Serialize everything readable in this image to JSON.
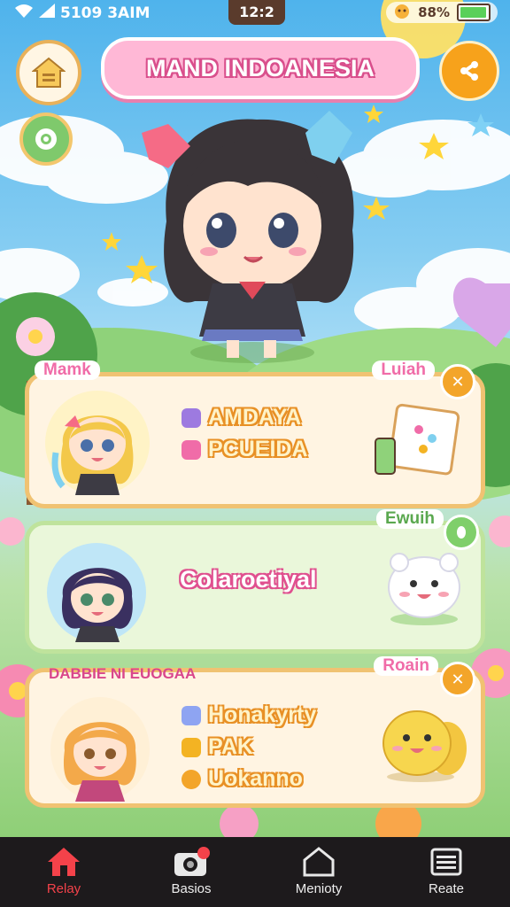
{
  "status_bar": {
    "left_text": "5109 3AIM",
    "time": "12:2",
    "battery_text": "88%",
    "battery_level": 0.85
  },
  "header": {
    "title": "MAND INDOANESIA"
  },
  "cards": [
    {
      "tag": "Mamk",
      "side_tag": "Luiah",
      "badge": "✕",
      "badge_color": "#f3a52a",
      "items": [
        {
          "label": "AMDAYA",
          "bullet_color": "#9d7ae0"
        },
        {
          "label": "PCUEIDA",
          "bullet_color": "#f06ca8"
        }
      ]
    },
    {
      "side_tag": "Ewuih",
      "badge_color": "#7fcf6a",
      "items": [
        {
          "label": "Colaroetiyal"
        }
      ]
    },
    {
      "tag": "DABBIE NI EUOGAA",
      "side_tag": "Roain",
      "badge": "✕",
      "badge_color": "#f3a52a",
      "items": [
        {
          "label": "Honakyrty",
          "bullet_color": "#8ea4f2"
        },
        {
          "label": "PAK",
          "bullet_color": "#f3b323"
        },
        {
          "label": "Uokanno",
          "bullet_color": "#f3a52a"
        }
      ]
    }
  ],
  "nav": [
    {
      "label": "Relay",
      "icon": "home-icon",
      "active": true
    },
    {
      "label": "Basios",
      "icon": "camera-icon",
      "active": false
    },
    {
      "label": "Menioty",
      "icon": "house-outline-icon",
      "active": false
    },
    {
      "label": "Reate",
      "icon": "menu-icon",
      "active": false
    }
  ],
  "colors": {
    "accent_pink": "#f06ca8",
    "accent_orange": "#f3a52a",
    "nav_active": "#f4424a",
    "nav_bg": "#1d1a1c"
  }
}
